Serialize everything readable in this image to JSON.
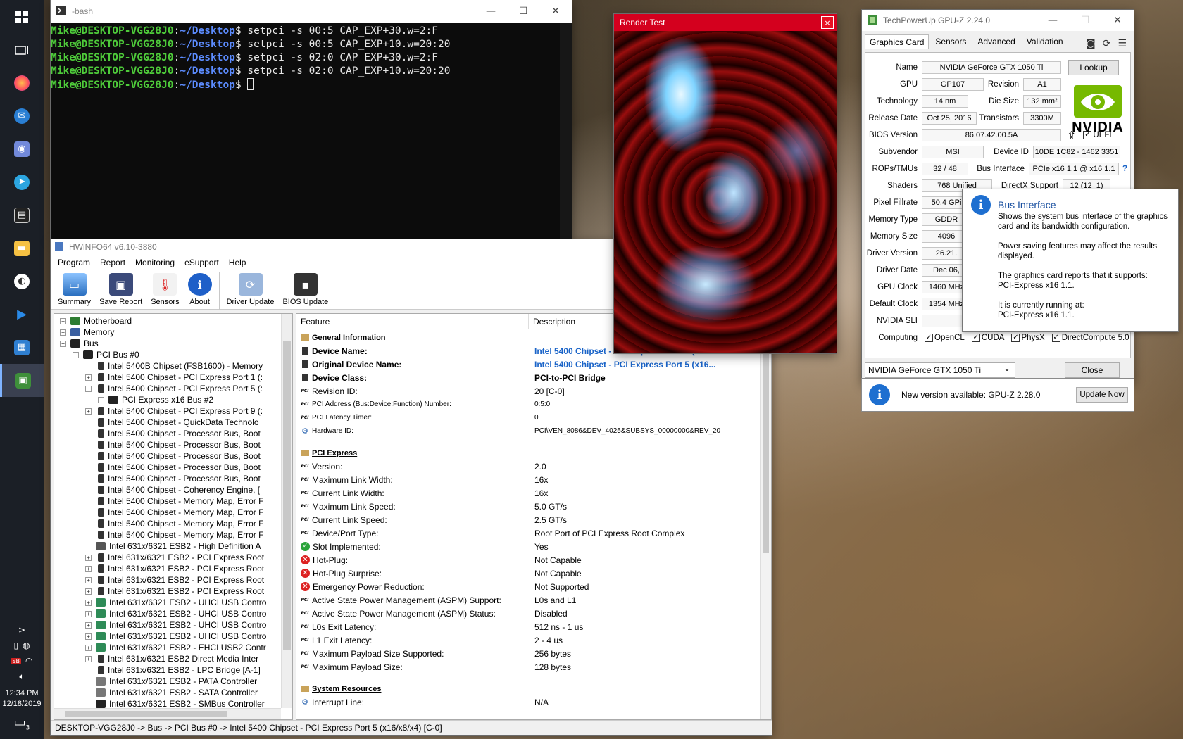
{
  "taskbar": {
    "clock_time": "12:34 PM",
    "clock_date": "12/18/2019",
    "tray_expand": ">",
    "notif_count": "3",
    "icons": [
      "windows-start-icon",
      "task-view-icon",
      "firefox-icon",
      "thunderbird-icon",
      "discord-icon",
      "telegram-icon",
      "terminal-icon",
      "file-explorer-icon",
      "chrome-remote-icon",
      "media-player-icon",
      "calculator-icon",
      "gpu-z-icon"
    ]
  },
  "terminal": {
    "title": "-bash",
    "user_host": "Mike@DESKTOP-VGG28J0",
    "sep": ":",
    "path": "~/Desktop",
    "dollar": "$",
    "commands": [
      " setpci -s 00:5 CAP_EXP+30.w=2:F",
      " setpci -s 00:5 CAP_EXP+10.w=20:20",
      " setpci -s 02:0 CAP_EXP+30.w=2:F",
      " setpci -s 02:0 CAP_EXP+10.w=20:20",
      " "
    ]
  },
  "hwinfo": {
    "title": "HWiNFO64 v6.10-3880",
    "menu": [
      "Program",
      "Report",
      "Monitoring",
      "eSupport",
      "Help"
    ],
    "tools": [
      {
        "label": "Summary",
        "icon": "monitor-icon"
      },
      {
        "label": "Save Report",
        "icon": "floppy-icon"
      },
      {
        "label": "Sensors",
        "icon": "thermometer-icon"
      },
      {
        "label": "About",
        "icon": "info-icon"
      },
      {
        "label": "Driver Update",
        "icon": "driver-update-icon"
      },
      {
        "label": "BIOS Update",
        "icon": "chip-icon"
      }
    ],
    "tree": [
      {
        "indent": 1,
        "tw": "+",
        "text": "Motherboard",
        "icon": "board"
      },
      {
        "indent": 1,
        "tw": "+",
        "text": "Memory",
        "icon": "mem"
      },
      {
        "indent": 1,
        "tw": "-",
        "text": "Bus",
        "icon": "bus"
      },
      {
        "indent": 2,
        "tw": "-",
        "text": "PCI Bus #0",
        "icon": "pci"
      },
      {
        "indent": 3,
        "tw": "",
        "text": "Intel 5400B Chipset (FSB1600) - Memory",
        "icon": "chip"
      },
      {
        "indent": 3,
        "tw": "+",
        "text": "Intel 5400 Chipset - PCI Express Port 1 (:",
        "icon": "chip"
      },
      {
        "indent": 3,
        "tw": "-",
        "text": "Intel 5400 Chipset - PCI Express Port 5 (:",
        "icon": "chip"
      },
      {
        "indent": 4,
        "tw": "+",
        "text": "PCI Express x16 Bus #2",
        "icon": "pci"
      },
      {
        "indent": 3,
        "tw": "+",
        "text": "Intel 5400 Chipset - PCI Express Port 9 (:",
        "icon": "chip"
      },
      {
        "indent": 3,
        "tw": "",
        "text": "Intel 5400 Chipset - QuickData Technolo",
        "icon": "chip"
      },
      {
        "indent": 3,
        "tw": "",
        "text": "Intel 5400 Chipset - Processor Bus, Boot",
        "icon": "chip"
      },
      {
        "indent": 3,
        "tw": "",
        "text": "Intel 5400 Chipset - Processor Bus, Boot",
        "icon": "chip"
      },
      {
        "indent": 3,
        "tw": "",
        "text": "Intel 5400 Chipset - Processor Bus, Boot",
        "icon": "chip"
      },
      {
        "indent": 3,
        "tw": "",
        "text": "Intel 5400 Chipset - Processor Bus, Boot",
        "icon": "chip"
      },
      {
        "indent": 3,
        "tw": "",
        "text": "Intel 5400 Chipset - Processor Bus, Boot",
        "icon": "chip"
      },
      {
        "indent": 3,
        "tw": "",
        "text": "Intel 5400 Chipset - Coherency Engine, [",
        "icon": "chip"
      },
      {
        "indent": 3,
        "tw": "",
        "text": "Intel 5400 Chipset - Memory Map, Error F",
        "icon": "chip"
      },
      {
        "indent": 3,
        "tw": "",
        "text": "Intel 5400 Chipset - Memory Map, Error F",
        "icon": "chip"
      },
      {
        "indent": 3,
        "tw": "",
        "text": "Intel 5400 Chipset - Memory Map, Error F",
        "icon": "chip"
      },
      {
        "indent": 3,
        "tw": "",
        "text": "Intel 5400 Chipset - Memory Map, Error F",
        "icon": "chip"
      },
      {
        "indent": 3,
        "tw": "",
        "text": "Intel 631x/6321 ESB2 - High Definition A",
        "icon": "audio"
      },
      {
        "indent": 3,
        "tw": "+",
        "text": "Intel 631x/6321 ESB2 - PCI Express Root",
        "icon": "chip"
      },
      {
        "indent": 3,
        "tw": "+",
        "text": "Intel 631x/6321 ESB2 - PCI Express Root",
        "icon": "chip"
      },
      {
        "indent": 3,
        "tw": "+",
        "text": "Intel 631x/6321 ESB2 - PCI Express Root",
        "icon": "chip"
      },
      {
        "indent": 3,
        "tw": "+",
        "text": "Intel 631x/6321 ESB2 - PCI Express Root",
        "icon": "chip"
      },
      {
        "indent": 3,
        "tw": "+",
        "text": "Intel 631x/6321 ESB2 - UHCI USB Contro",
        "icon": "usb"
      },
      {
        "indent": 3,
        "tw": "+",
        "text": "Intel 631x/6321 ESB2 - UHCI USB Contro",
        "icon": "usb"
      },
      {
        "indent": 3,
        "tw": "+",
        "text": "Intel 631x/6321 ESB2 - UHCI USB Contro",
        "icon": "usb"
      },
      {
        "indent": 3,
        "tw": "+",
        "text": "Intel 631x/6321 ESB2 - UHCI USB Contro",
        "icon": "usb"
      },
      {
        "indent": 3,
        "tw": "+",
        "text": "Intel 631x/6321 ESB2 - EHCI USB2 Contr",
        "icon": "usb"
      },
      {
        "indent": 3,
        "tw": "+",
        "text": "Intel 631x/6321 ESB2 Direct Media Inter",
        "icon": "chip"
      },
      {
        "indent": 3,
        "tw": "",
        "text": "Intel 631x/6321 ESB2 - LPC Bridge [A-1]",
        "icon": "chip"
      },
      {
        "indent": 3,
        "tw": "",
        "text": "Intel 631x/6321 ESB2 - PATA Controller",
        "icon": "disk"
      },
      {
        "indent": 3,
        "tw": "",
        "text": "Intel 631x/6321 ESB2 - SATA Controller",
        "icon": "disk"
      },
      {
        "indent": 3,
        "tw": "",
        "text": "Intel 631x/6321 ESB2 - SMBus Controller",
        "icon": "bus"
      }
    ],
    "columns": {
      "feature": "Feature",
      "description": "Description"
    },
    "details": [
      {
        "type": "section",
        "f": "General Information"
      },
      {
        "type": "bold",
        "icon": "chip",
        "f": "Device Name:",
        "d": "Intel 5400 Chipset - PCI Express Port 5 (x16...",
        "dclass": "blue-bold"
      },
      {
        "type": "bold",
        "icon": "chip",
        "f": "Original Device Name:",
        "d": "Intel 5400 Chipset - PCI Express Port 5 (x16...",
        "dclass": "blue-bold"
      },
      {
        "type": "bold",
        "icon": "chip",
        "f": "Device Class:",
        "d": "PCI-to-PCI Bridge",
        "dclass": "bold"
      },
      {
        "type": "row",
        "icon": "pci",
        "f": "Revision ID:",
        "d": "20 [C-0]"
      },
      {
        "type": "small",
        "icon": "pci",
        "f": "PCI Address (Bus:Device:Function) Number:",
        "d": "0:5:0"
      },
      {
        "type": "small",
        "icon": "pci",
        "f": "PCI Latency Timer:",
        "d": "0"
      },
      {
        "type": "small",
        "icon": "gear",
        "f": "Hardware ID:",
        "d": "PCI\\VEN_8086&DEV_4025&SUBSYS_00000000&REV_20"
      },
      {
        "type": "blank"
      },
      {
        "type": "section",
        "f": "PCI Express"
      },
      {
        "type": "row",
        "icon": "pci",
        "f": "Version:",
        "d": "2.0"
      },
      {
        "type": "row",
        "icon": "pci",
        "f": "Maximum Link Width:",
        "d": "16x"
      },
      {
        "type": "row",
        "icon": "pci",
        "f": "Current Link Width:",
        "d": "16x"
      },
      {
        "type": "row",
        "icon": "pci",
        "f": "Maximum Link Speed:",
        "d": "5.0 GT/s"
      },
      {
        "type": "row",
        "icon": "pci",
        "f": "Current Link Speed:",
        "d": "2.5 GT/s"
      },
      {
        "type": "row",
        "icon": "pci",
        "f": "Device/Port Type:",
        "d": "Root Port of PCI Express Root Complex"
      },
      {
        "type": "row",
        "icon": "green",
        "f": "Slot Implemented:",
        "d": "Yes"
      },
      {
        "type": "row",
        "icon": "red",
        "f": "Hot-Plug:",
        "d": "Not Capable"
      },
      {
        "type": "row",
        "icon": "red",
        "f": "Hot-Plug Surprise:",
        "d": "Not Capable"
      },
      {
        "type": "row",
        "icon": "red",
        "f": "Emergency Power Reduction:",
        "d": "Not Supported"
      },
      {
        "type": "row",
        "icon": "pci",
        "f": "Active State Power Management (ASPM) Support:",
        "d": "L0s and L1"
      },
      {
        "type": "row",
        "icon": "pci",
        "f": "Active State Power Management (ASPM) Status:",
        "d": "Disabled"
      },
      {
        "type": "row",
        "icon": "pci",
        "f": "L0s Exit Latency:",
        "d": "512 ns - 1 us"
      },
      {
        "type": "row",
        "icon": "pci",
        "f": "L1 Exit Latency:",
        "d": "2 - 4 us"
      },
      {
        "type": "row",
        "icon": "pci",
        "f": "Maximum Payload Size Supported:",
        "d": "256 bytes"
      },
      {
        "type": "row",
        "icon": "pci",
        "f": "Maximum Payload Size:",
        "d": "128 bytes"
      },
      {
        "type": "blank"
      },
      {
        "type": "section",
        "f": "System Resources"
      },
      {
        "type": "row",
        "icon": "gear",
        "f": "Interrupt Line:",
        "d": "N/A"
      }
    ],
    "statusbar": "DESKTOP-VGG28J0 -> Bus -> PCI Bus #0 -> Intel 5400 Chipset - PCI Express Port 5 (x16/x8/x4) [C-0]"
  },
  "render": {
    "title": "Render Test",
    "close": "×"
  },
  "gpuz": {
    "title": "TechPowerUp GPU-Z 2.24.0",
    "tabs": [
      "Graphics Card",
      "Sensors",
      "Advanced",
      "Validation"
    ],
    "name_label": "Name",
    "name": "NVIDIA GeForce GTX 1050 Ti",
    "lookup": "Lookup",
    "gpu_label": "GPU",
    "gpu": "GP107",
    "revision_label": "Revision",
    "revision": "A1",
    "tech_label": "Technology",
    "tech": "14 nm",
    "die_label": "Die Size",
    "die": "132 mm²",
    "release_label": "Release Date",
    "release": "Oct 25, 2016",
    "trans_label": "Transistors",
    "trans": "3300M",
    "bios_label": "BIOS Version",
    "bios": "86.07.42.00.5A",
    "uefi": "UEFI",
    "subvendor_label": "Subvendor",
    "subvendor": "MSI",
    "devid_label": "Device ID",
    "devid": "10DE 1C82 - 1462 3351",
    "rops_label": "ROPs/TMUs",
    "rops": "32 / 48",
    "bus_label": "Bus Interface",
    "bus": "PCIe x16 1.1 @ x16 1.1",
    "bus_help": "?",
    "shaders_label": "Shaders",
    "shaders": "768 Unified",
    "dx_label": "DirectX Support",
    "dx": "12 (12_1)",
    "pixel_label": "Pixel Fillrate",
    "pixel": "50.4 GPi",
    "memtype_label": "Memory Type",
    "memtype": "GDDR",
    "memsize_label": "Memory Size",
    "memsize": "4096",
    "driver_label": "Driver Version",
    "driver": "26.21.",
    "driverdate_label": "Driver Date",
    "driverdate": "Dec 06,",
    "gpuclock_label": "GPU Clock",
    "gpuclock": "1460 MHz",
    "defclock_label": "Default Clock",
    "defclock": "1354 MHz",
    "sli_label": "NVIDIA SLI",
    "sli": "",
    "computing_label": "Computing",
    "computing": [
      "OpenCL",
      "CUDA",
      "PhysX",
      "DirectCompute 5.0"
    ],
    "selected_card": "NVIDIA GeForce GTX 1050 Ti",
    "close": "Close",
    "nvidia_text": "NVIDIA",
    "update_text": "New version available: GPU-Z 2.28.0",
    "update_btn": "Update Now"
  },
  "tooltip": {
    "title": "Bus Interface",
    "p1": "Shows the system bus interface of the graphics card and its bandwidth configuration.",
    "p2": "Power saving features may affect the results displayed.",
    "p3a": "The graphics card reports that it supports:",
    "p3b": "PCI-Express x16 1.1.",
    "p4a": "It is currently running at:",
    "p4b": "PCI-Express x16 1.1."
  }
}
